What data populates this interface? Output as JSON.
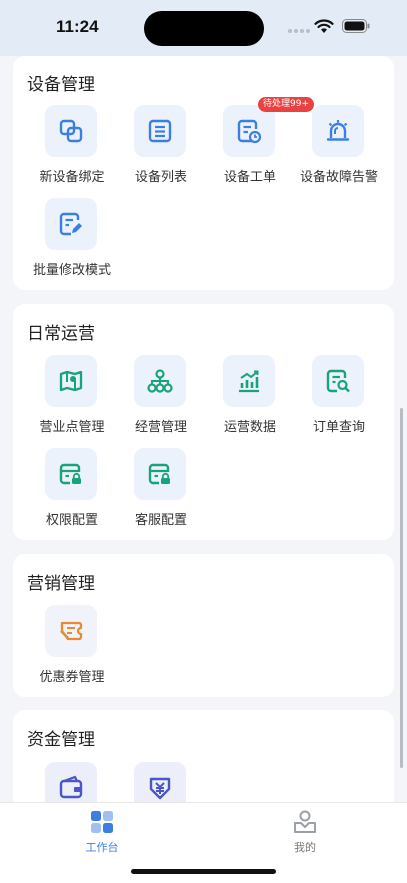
{
  "status": {
    "time": "11:24"
  },
  "sections": {
    "device": {
      "title": "设备管理",
      "items": [
        {
          "label": "新设备绑定",
          "icon": "link-icon"
        },
        {
          "label": "设备列表",
          "icon": "list-icon"
        },
        {
          "label": "设备工单",
          "icon": "work-order-icon",
          "badge": "待处理99+"
        },
        {
          "label": "设备故障告警",
          "icon": "alarm-light-icon"
        },
        {
          "label": "批量修改模式",
          "icon": "batch-edit-icon"
        }
      ]
    },
    "operations": {
      "title": "日常运营",
      "items": [
        {
          "label": "营业点管理",
          "icon": "map-icon"
        },
        {
          "label": "经营管理",
          "icon": "org-chart-icon"
        },
        {
          "label": "运营数据",
          "icon": "chart-icon"
        },
        {
          "label": "订单查询",
          "icon": "order-search-icon"
        },
        {
          "label": "权限配置",
          "icon": "permission-icon"
        },
        {
          "label": "客服配置",
          "icon": "customer-service-icon"
        }
      ]
    },
    "marketing": {
      "title": "营销管理",
      "items": [
        {
          "label": "优惠券管理",
          "icon": "coupon-icon"
        }
      ]
    },
    "finance": {
      "title": "资金管理",
      "items": [
        {
          "label": "",
          "icon": "wallet-icon"
        },
        {
          "label": "",
          "icon": "yuan-icon"
        }
      ]
    }
  },
  "tabs": [
    {
      "label": "工作台",
      "icon": "workbench-icon",
      "active": true
    },
    {
      "label": "我的",
      "icon": "profile-icon",
      "active": false
    }
  ],
  "colors": {
    "accent_blue": "#3d7fe0",
    "accent_green": "#1aa37a",
    "accent_orange": "#e98a2e",
    "accent_purple": "#4a56c9",
    "badge_red": "#e84242"
  }
}
